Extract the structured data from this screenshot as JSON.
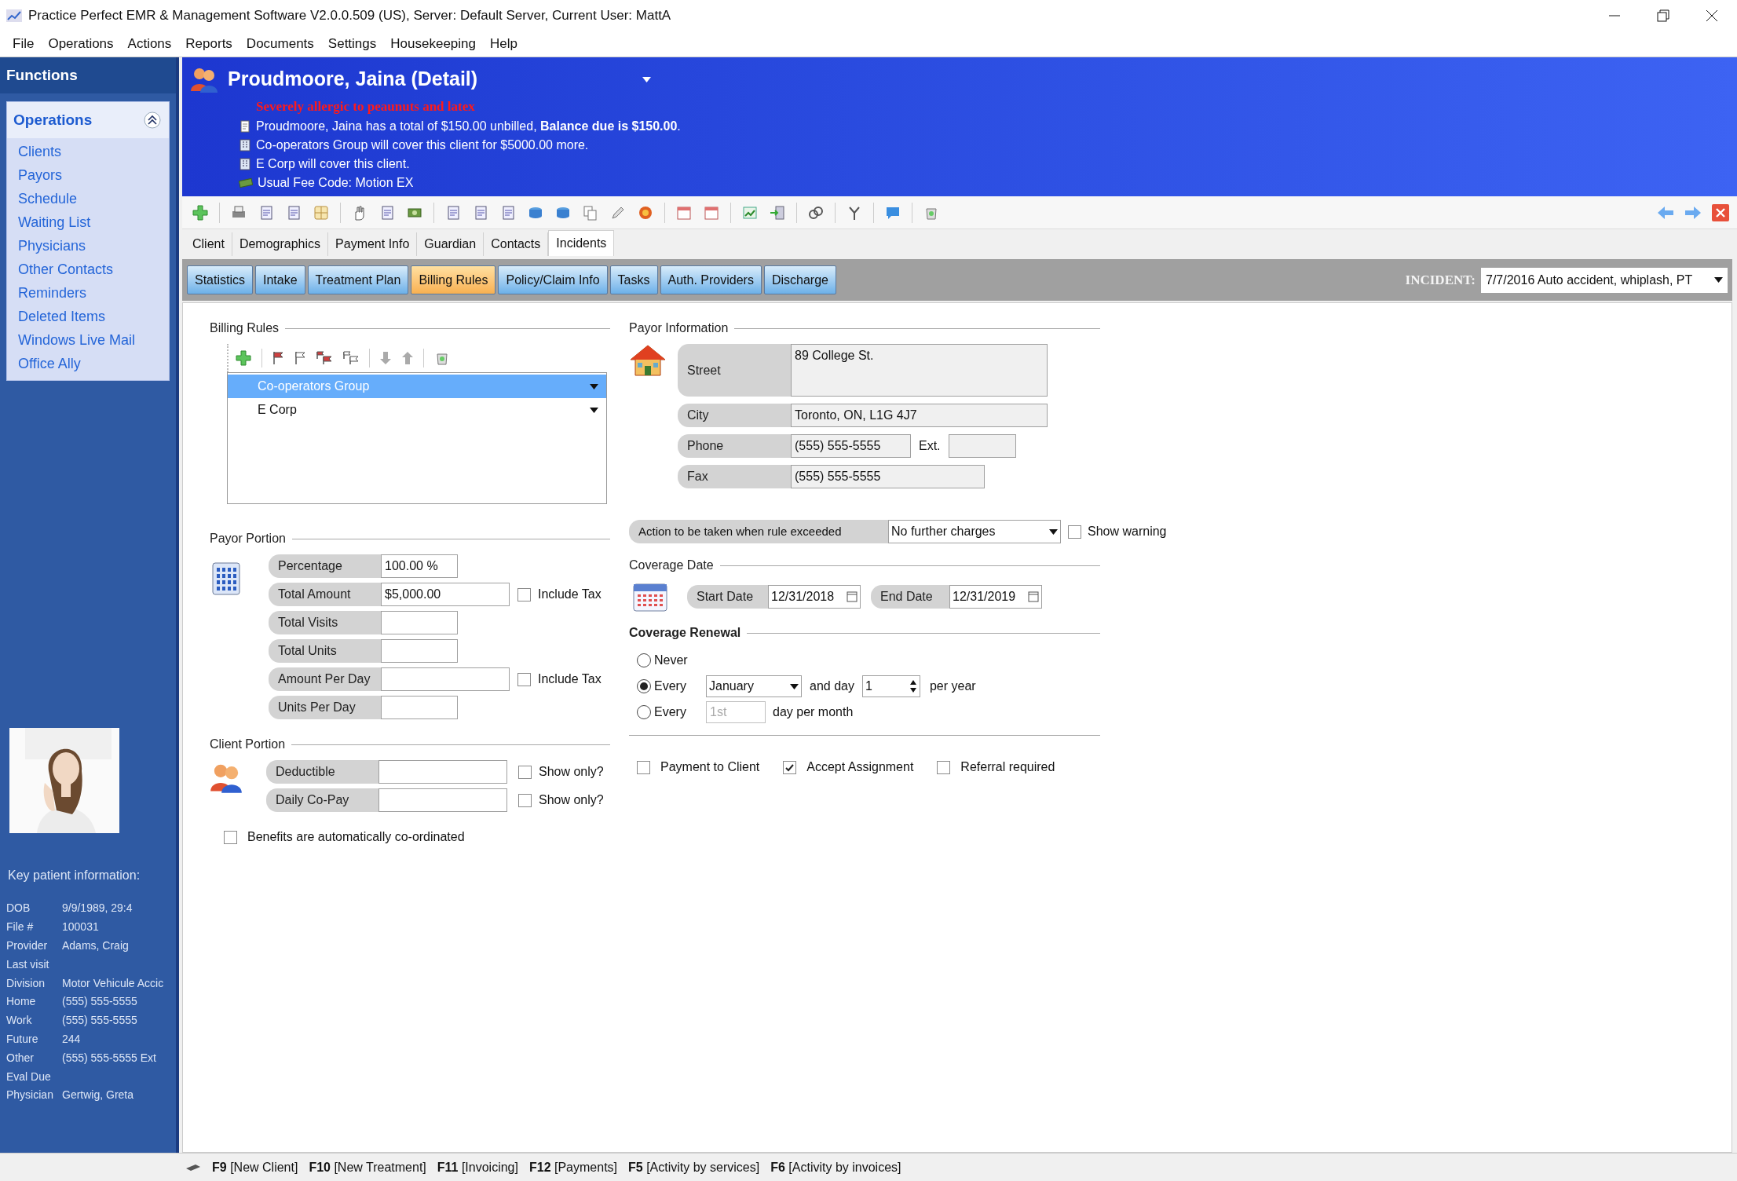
{
  "window": {
    "title": "Practice Perfect EMR & Management Software V2.0.0.509 (US), Server: Default Server, Current User: MattA"
  },
  "menu": [
    "File",
    "Operations",
    "Actions",
    "Reports",
    "Documents",
    "Settings",
    "Housekeeping",
    "Help"
  ],
  "sidebar": {
    "header": "Functions",
    "section": {
      "title": "Operations",
      "expanded": true
    },
    "items": [
      "Clients",
      "Payors",
      "Schedule",
      "Waiting List",
      "Physicians",
      "Other Contacts",
      "Reminders",
      "Deleted Items",
      "Windows Live Mail",
      "Office Ally"
    ],
    "photo": {
      "kind": "picture"
    },
    "key_info_title": "Key patient information:",
    "key_info": [
      {
        "label": "DOB",
        "value": "9/9/1989, 29:4"
      },
      {
        "label": "File #",
        "value": "100031"
      },
      {
        "label": "Provider",
        "value": "Adams, Craig"
      },
      {
        "label": "Last visit"
      },
      {
        "label": "Division",
        "value": "Motor Vehicule Accic"
      },
      {
        "label": "Home",
        "value": "(555) 555-5555"
      },
      {
        "label": "Work",
        "value": "(555) 555-5555"
      },
      {
        "label": "Future",
        "value": "244"
      },
      {
        "label": "Other",
        "value": "(555) 555-5555 Ext"
      },
      {
        "label": "Eval Due"
      },
      {
        "label": "Physician",
        "value": "Gertwig, Greta"
      }
    ]
  },
  "patient": {
    "name": "Proudmoore, Jaina (Detail)",
    "alert": "Severely allergic to peaunuts and latex",
    "notes": [
      {
        "kind": "balance",
        "text": "Proudmoore, Jaina has a total of $150.00 unbilled, **Balance due is $150.00**."
      },
      {
        "kind": "payor",
        "text": "Co-operators Group will cover this client for $5000.00 more."
      },
      {
        "kind": "payor",
        "text": "E Corp will cover this client."
      },
      {
        "kind": "fee",
        "text": "Usual Fee Code: Motion EX"
      }
    ]
  },
  "tabs": [
    {
      "label": "Client",
      "selected": false
    },
    {
      "label": "Demographics",
      "selected": false
    },
    {
      "label": "Payment Info",
      "selected": false
    },
    {
      "label": "Guardian",
      "selected": false
    },
    {
      "label": "Contacts",
      "selected": false
    },
    {
      "label": "Incidents",
      "selected": true
    }
  ],
  "subtabs": [
    {
      "label": "Statistics",
      "selected": false
    },
    {
      "label": "Intake",
      "selected": false
    },
    {
      "label": "Treatment Plan",
      "selected": false
    },
    {
      "label": "Billing Rules",
      "selected": true
    },
    {
      "label": "Policy/Claim Info",
      "selected": false
    },
    {
      "label": "Tasks",
      "selected": false
    },
    {
      "label": "Auth. Providers",
      "selected": false
    },
    {
      "label": "Discharge",
      "selected": false
    }
  ],
  "incident": {
    "label": "INCIDENT:",
    "value": "7/7/2016 Auto accident, whiplash, PT"
  },
  "billing_rules": {
    "title": "Billing Rules",
    "rows": [
      {
        "name": "Co-operators Group",
        "selected": true
      },
      {
        "name": "E Corp",
        "selected": false
      }
    ]
  },
  "payor_information": {
    "title": "Payor Information",
    "fields": [
      {
        "label": "Street",
        "value": "89 College St."
      },
      {
        "label": "City",
        "value": "Toronto, ON, L1G 4J7"
      },
      {
        "label": "Phone",
        "value": "(555) 555-5555",
        "ext_label": "Ext."
      },
      {
        "label": "Fax",
        "value": "(555) 555-5555"
      }
    ]
  },
  "payor_portion": {
    "title": "Payor Portion",
    "fields": [
      {
        "label": "Percentage",
        "value": "100.00 %"
      },
      {
        "label": "Total Amount",
        "value": "$5,000.00",
        "checkbox": {
          "label": "Include Tax",
          "checked": false
        }
      },
      {
        "label": "Total Visits"
      },
      {
        "label": "Total Units"
      },
      {
        "label": "Amount Per Day",
        "checkbox": {
          "label": "Include Tax",
          "checked": false
        }
      },
      {
        "label": "Units Per Day"
      }
    ]
  },
  "action": {
    "label": "Action to be taken when rule exceeded",
    "value": "No further charges",
    "show_warning": {
      "label": "Show warning",
      "checked": false
    }
  },
  "coverage_date": {
    "title": "Coverage Date",
    "start_label": "Start Date",
    "start": "12/31/2018",
    "end_label": "End Date",
    "end": "12/31/2019"
  },
  "coverage_renewal": {
    "title": "Coverage Renewal",
    "options": [
      {
        "kind": "plain",
        "label": "Never",
        "selected": false
      },
      {
        "kind": "yearly",
        "label": "Every",
        "selected": true,
        "month": "January",
        "day_label": "and day",
        "day": "1",
        "suffix": "per year"
      },
      {
        "kind": "monthly",
        "label": "Every",
        "selected": false,
        "placeholder": "1st",
        "suffix": "day per month"
      }
    ]
  },
  "client_portion": {
    "title": "Client Portion",
    "fields": [
      {
        "label": "Deductible",
        "checkbox": {
          "label": "Show only?",
          "checked": false
        }
      },
      {
        "label": "Daily Co-Pay",
        "checkbox": {
          "label": "Show only?",
          "checked": false
        }
      }
    ]
  },
  "benefits": {
    "label": "Benefits are automatically co-ordinated",
    "checked": false
  },
  "options": [
    {
      "label": "Payment to Client",
      "checked": false
    },
    {
      "label": "Accept Assignment",
      "checked": true
    },
    {
      "label": "Referral required",
      "checked": false
    }
  ],
  "status_bar": [
    {
      "key": "F9",
      "label": "[New Client]"
    },
    {
      "key": "F10",
      "label": "[New Treatment]"
    },
    {
      "key": "F11",
      "label": "[Invoicing]"
    },
    {
      "key": "F12",
      "label": "[Payments]"
    },
    {
      "key": "F5",
      "label": "[Activity by services]"
    },
    {
      "key": "F6",
      "label": "[Activity by invoices]"
    }
  ]
}
